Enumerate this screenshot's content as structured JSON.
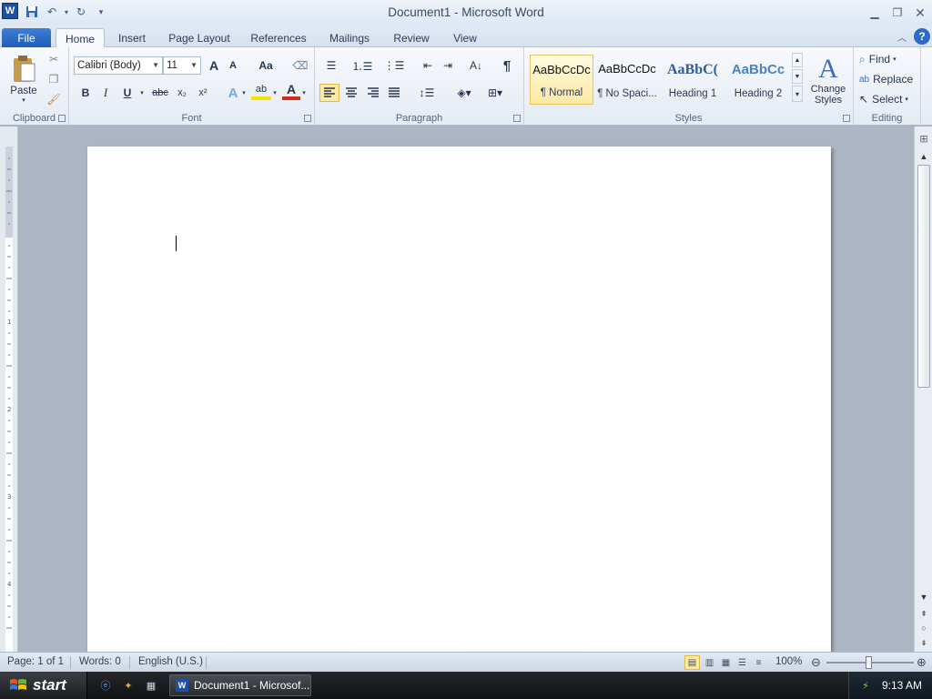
{
  "window": {
    "title": "Document1 - Microsoft Word",
    "app_logo_letter": "W"
  },
  "tabs": [
    {
      "label": "File"
    },
    {
      "label": "Home"
    },
    {
      "label": "Insert"
    },
    {
      "label": "Page Layout"
    },
    {
      "label": "References"
    },
    {
      "label": "Mailings"
    },
    {
      "label": "Review"
    },
    {
      "label": "View"
    }
  ],
  "ribbon": {
    "clipboard": {
      "group_label": "Clipboard",
      "paste_label": "Paste"
    },
    "font": {
      "group_label": "Font",
      "font_name": "Calibri (Body)",
      "font_size": "11",
      "grow_label": "A",
      "shrink_label": "A",
      "change_case_label": "Aa",
      "bold_label": "B",
      "italic_label": "I",
      "underline_label": "U",
      "strike_label": "abc",
      "subscript_label": "x₂",
      "superscript_label": "x²",
      "effects_label": "A",
      "highlight_label": "ab",
      "font_color_label": "A"
    },
    "paragraph": {
      "group_label": "Paragraph",
      "pilcrow": "¶"
    },
    "styles": {
      "group_label": "Styles",
      "items": [
        {
          "sample": "AaBbCcDc",
          "name": "¶ Normal"
        },
        {
          "sample": "AaBbCcDc",
          "name": "¶ No Spaci..."
        },
        {
          "sample": "AaBbC(",
          "name": "Heading 1"
        },
        {
          "sample": "AaBbCc",
          "name": "Heading 2"
        }
      ],
      "change_styles_label": "Change Styles"
    },
    "editing": {
      "group_label": "Editing",
      "find_label": "Find",
      "replace_label": "Replace",
      "select_label": "Select"
    }
  },
  "status": {
    "page": "Page: 1 of 1",
    "words": "Words: 0",
    "language": "English (U.S.)",
    "zoom": "100%",
    "zoom_level_percent": 100
  },
  "taskbar": {
    "start_label": "start",
    "word_task_label": "Document1 - Microsof...",
    "clock": "9:13 AM"
  },
  "colors": {
    "file_tab": "#1f5db8",
    "active_style_highlight": "#fde9a3",
    "heading_blue": "#2e5c99",
    "font_color_red": "#d52b1e",
    "highlight_yellow": "#f5e300"
  }
}
